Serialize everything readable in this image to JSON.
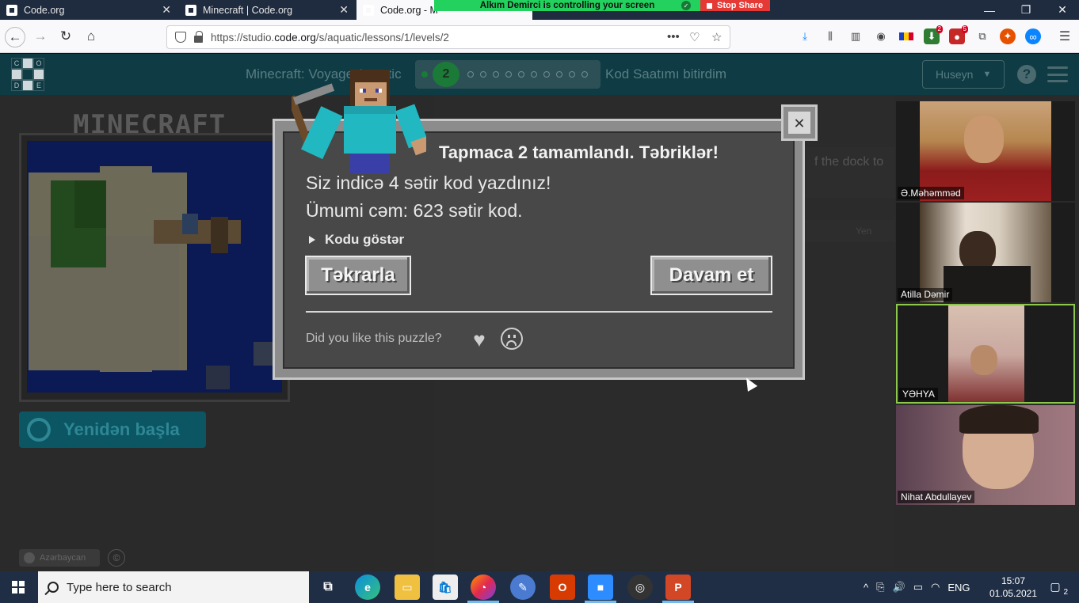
{
  "browser": {
    "tabs": [
      {
        "title": "Code.org"
      },
      {
        "title": "Minecraft | Code.org"
      },
      {
        "title": "Code.org - M"
      }
    ],
    "share_banner": "Alkım Demirci is controlling your screen",
    "stop_share_label": "Stop Share",
    "url_prefix": "https://studio.",
    "url_domain": "code.org",
    "url_path": "/s/aquatic/lessons/1/levels/2"
  },
  "header": {
    "logo_letters": [
      "C",
      "O",
      "D",
      "E"
    ],
    "lesson_title": "Minecraft: Voyage Aquatic",
    "current_level": "2",
    "hour_of_code_done": "Kod Saatımı bitirdim",
    "user_name": "Huseyn"
  },
  "game": {
    "brand": "MINECRAFT",
    "restart_label": "Yenidən başla",
    "language": "Azərbaycan"
  },
  "instructions": {
    "partial_text": "f the dock to",
    "reset_label": "Yen"
  },
  "modal": {
    "heading": "Tapmaca 2 tamamlandı. Təbriklər!",
    "line1": "Siz indicə 4 sətir kod yazdınız!",
    "line2": "Ümumi cəm: 623 sətir kod.",
    "show_code": "Kodu göstər",
    "replay_label": "Təkrarla",
    "continue_label": "Davam et",
    "feedback_question": "Did you like this puzzle?",
    "close_icon": "close-icon"
  },
  "participants": [
    {
      "name": "Ə.Məhəmməd"
    },
    {
      "name": "Atilla Dəmir"
    },
    {
      "name": "YƏHYA",
      "active": true
    },
    {
      "name": "Nihat Abdullayev"
    }
  ],
  "taskbar": {
    "search_placeholder": "Type here to search",
    "language": "ENG",
    "time": "15:07",
    "date": "01.05.2021",
    "notification_count": "2"
  },
  "colors": {
    "header_bg": "#0f3b44",
    "share_green": "#23d15f",
    "stop_red": "#e53935",
    "taskbar_bg": "#1f2e45"
  }
}
